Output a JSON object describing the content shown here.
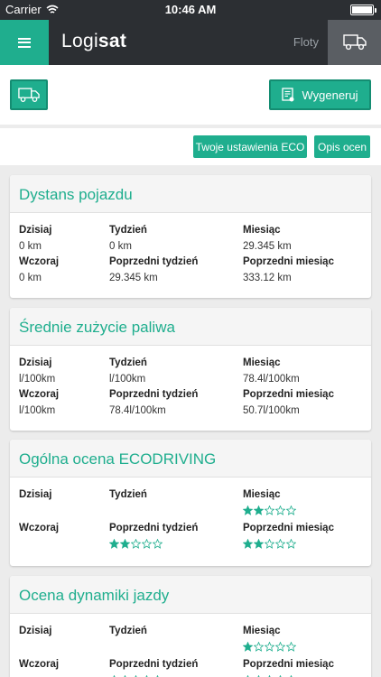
{
  "status": {
    "carrier": "Carrier",
    "time": "10:46 AM"
  },
  "header": {
    "logo_light": "Logi",
    "logo_bold": "sat",
    "fleets_label": "Floty"
  },
  "toolbar": {
    "generate_label": "Wygeneruj",
    "eco_settings_label": "Twoje ustawienia ECO",
    "ratings_label": "Opis ocen"
  },
  "labels": {
    "today": "Dzisiaj",
    "week": "Tydzień",
    "month": "Miesiąc",
    "yesterday": "Wczoraj",
    "prev_week": "Poprzedni tydzień",
    "prev_month": "Poprzedni miesiąc"
  },
  "cards": [
    {
      "title": "Dystans pojazdu",
      "values": {
        "today": "0 km",
        "week": "0 km",
        "month": "29.345 km",
        "yesterday": "0 km",
        "prev_week": "29.345 km",
        "prev_month": "333.12 km"
      }
    },
    {
      "title": "Średnie zużycie paliwa",
      "values": {
        "today": "l/100km",
        "week": "l/100km",
        "month": "78.4l/100km",
        "yesterday": "l/100km",
        "prev_week": "78.4l/100km",
        "prev_month": "50.7l/100km"
      }
    },
    {
      "title": "Ogólna ocena ECODRIVING",
      "stars": {
        "month": 2,
        "prev_week": 2,
        "prev_month": 2
      }
    },
    {
      "title": "Ocena dynamiki jazdy",
      "stars": {
        "month": 1,
        "prev_week": 0,
        "prev_month": 0
      }
    }
  ],
  "colors": {
    "accent": "#1fae8e",
    "header": "#2c2f33"
  },
  "icons": {
    "menu": "hamburger-icon",
    "truck": "truck-icon",
    "report": "report-icon",
    "wifi": "wifi-icon",
    "battery": "battery-icon"
  }
}
